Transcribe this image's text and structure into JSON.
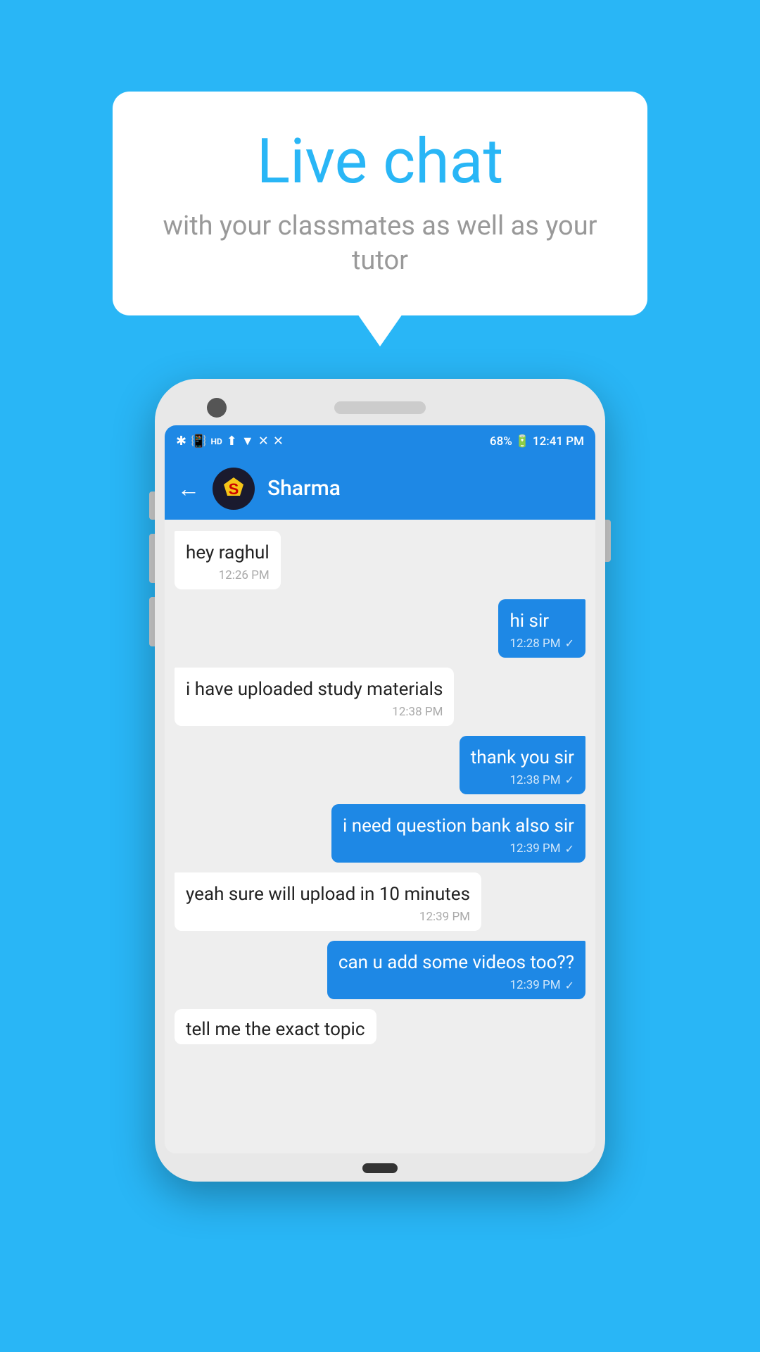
{
  "background_color": "#29b6f6",
  "bubble": {
    "title": "Live chat",
    "subtitle": "with your classmates as well as your tutor"
  },
  "phone": {
    "status_bar": {
      "left_icons": [
        "BT",
        "HD",
        "▲",
        "✕",
        "✕"
      ],
      "battery_percent": "68%",
      "time": "12:41 PM"
    },
    "chat_header": {
      "back_label": "←",
      "contact_name": "Sharma",
      "avatar_alt": "Superman logo"
    },
    "messages": [
      {
        "id": 1,
        "type": "received",
        "text": "hey raghul",
        "time": "12:26 PM",
        "tick": ""
      },
      {
        "id": 2,
        "type": "sent",
        "text": "hi sir",
        "time": "12:28 PM",
        "tick": "✓"
      },
      {
        "id": 3,
        "type": "received",
        "text": "i have uploaded study materials",
        "time": "12:38 PM",
        "tick": ""
      },
      {
        "id": 4,
        "type": "sent",
        "text": "thank you sir",
        "time": "12:38 PM",
        "tick": "✓"
      },
      {
        "id": 5,
        "type": "sent",
        "text": "i need question bank also sir",
        "time": "12:39 PM",
        "tick": "✓"
      },
      {
        "id": 6,
        "type": "received",
        "text": "yeah sure will upload in 10 minutes",
        "time": "12:39 PM",
        "tick": ""
      },
      {
        "id": 7,
        "type": "sent",
        "text": "can u add some videos too??",
        "time": "12:39 PM",
        "tick": "✓"
      },
      {
        "id": 8,
        "type": "received",
        "text": "tell me the exact topic",
        "time": "",
        "tick": "",
        "partial": true
      }
    ]
  }
}
